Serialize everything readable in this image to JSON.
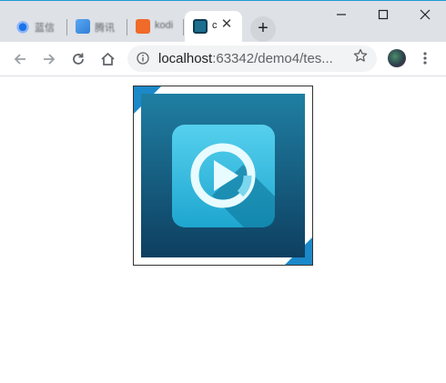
{
  "browser": {
    "tabs": [
      {
        "title": "蓝信",
        "active": false
      },
      {
        "title": "腾讯",
        "active": false
      },
      {
        "title": "kodi",
        "active": false
      },
      {
        "title": "c",
        "active": true
      }
    ],
    "new_tab_icon": "plus-icon",
    "window_controls": [
      "minimize-icon",
      "maximize-icon",
      "close-icon"
    ],
    "address": {
      "host": "localhost",
      "path": ":63342/demo4/tes..."
    },
    "accent_color": "#1b88c9"
  },
  "page": {
    "image_icon": "play-video-icon",
    "frame_corner_color": "#1b88c9"
  }
}
